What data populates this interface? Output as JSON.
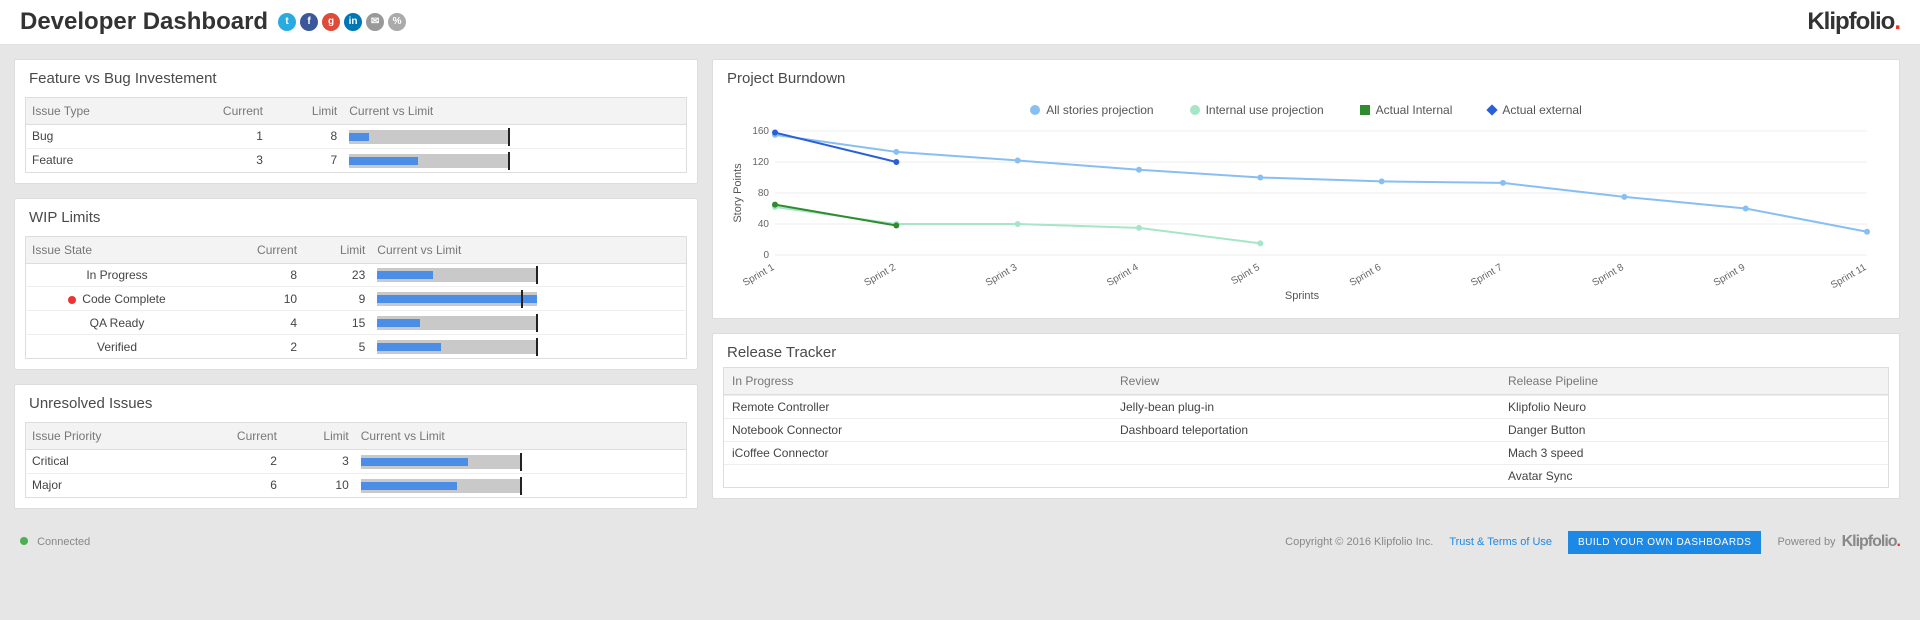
{
  "header": {
    "title": "Developer Dashboard",
    "brand": "Klipfolio",
    "social": [
      "twitter",
      "facebook",
      "google-plus",
      "linkedin",
      "email",
      "link"
    ]
  },
  "feature_vs_bug": {
    "title": "Feature vs Bug Investement",
    "cols": [
      "Issue Type",
      "Current",
      "Limit",
      "Current vs Limit"
    ],
    "rows": [
      {
        "type": "Bug",
        "current": 1,
        "limit": 8
      },
      {
        "type": "Feature",
        "current": 3,
        "limit": 7
      }
    ]
  },
  "wip": {
    "title": "WIP Limits",
    "cols": [
      "Issue State",
      "Current",
      "Limit",
      "Current vs Limit"
    ],
    "rows": [
      {
        "state": "In Progress",
        "current": 8,
        "limit": 23,
        "flag": false
      },
      {
        "state": "Code Complete",
        "current": 10,
        "limit": 9,
        "flag": true
      },
      {
        "state": "QA Ready",
        "current": 4,
        "limit": 15,
        "flag": false
      },
      {
        "state": "Verified",
        "current": 2,
        "limit": 5,
        "flag": false
      }
    ]
  },
  "unresolved": {
    "title": "Unresolved Issues",
    "cols": [
      "Issue Priority",
      "Current",
      "Limit",
      "Current vs Limit"
    ],
    "rows": [
      {
        "priority": "Critical",
        "current": 2,
        "limit": 3
      },
      {
        "priority": "Major",
        "current": 6,
        "limit": 10
      }
    ]
  },
  "burndown": {
    "title": "Project Burndown",
    "legend": {
      "all": "All stories projection",
      "int": "Internal use projection",
      "actI": "Actual Internal",
      "actE": "Actual external"
    }
  },
  "chart_data": {
    "type": "line",
    "title": "Project Burndown",
    "xlabel": "Sprints",
    "ylabel": "Story Points",
    "ylim": [
      0,
      160
    ],
    "yticks": [
      0,
      40,
      80,
      120,
      160
    ],
    "categories": [
      "Sprint 1",
      "Sprint 2",
      "Sprint 3",
      "Sprint 4",
      "Spint 5",
      "Sprint 6",
      "Sprint 7",
      "Sprint 8",
      "Sprint 9",
      "Sprint 11"
    ],
    "series": [
      {
        "name": "All stories projection",
        "key": "all",
        "color": "#88bff2",
        "dash": false,
        "values": [
          155,
          133,
          122,
          110,
          100,
          95,
          93,
          75,
          60,
          30
        ]
      },
      {
        "name": "Internal use projection",
        "key": "int",
        "color": "#a7e5c7",
        "dash": false,
        "values": [
          62,
          40,
          40,
          35,
          15,
          null,
          null,
          null,
          null,
          null
        ]
      },
      {
        "name": "Actual Internal",
        "key": "actI",
        "color": "#2e8b2e",
        "dash": false,
        "values": [
          65,
          38,
          null,
          null,
          null,
          null,
          null,
          null,
          null,
          null
        ]
      },
      {
        "name": "Actual external",
        "key": "actE",
        "color": "#2b5fd9",
        "dash": false,
        "values": [
          158,
          120,
          null,
          null,
          null,
          null,
          null,
          null,
          null,
          null
        ]
      }
    ]
  },
  "release": {
    "title": "Release Tracker",
    "cols": [
      "In Progress",
      "Review",
      "Release Pipeline"
    ],
    "in_progress": [
      "Remote Controller",
      "Notebook Connector",
      "iCoffee Connector"
    ],
    "review": [
      "Jelly-bean plug-in",
      "Dashboard teleportation"
    ],
    "pipeline": [
      "Klipfolio Neuro",
      "Danger Button",
      "Mach 3 speed",
      "Avatar Sync"
    ]
  },
  "footer": {
    "status": "Connected",
    "copyright": "Copyright © 2016 Klipfolio Inc.",
    "terms": "Trust & Terms of Use",
    "cta": "BUILD YOUR OWN DASHBOARDS",
    "powered": "Powered by"
  }
}
